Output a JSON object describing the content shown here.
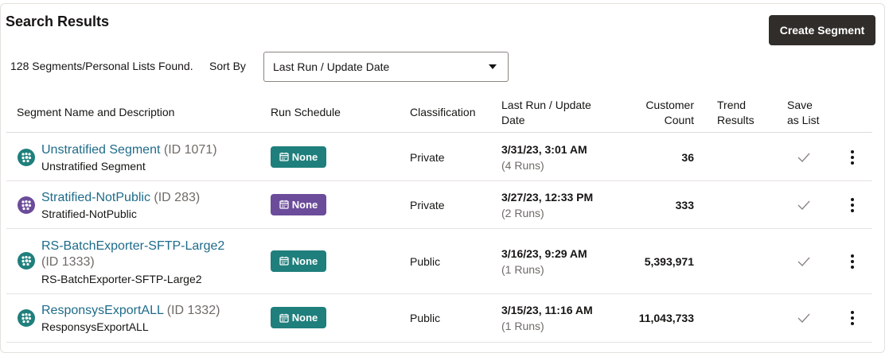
{
  "header": {
    "title": "Search Results",
    "create_button": "Create Segment"
  },
  "summary": {
    "found_text": "128 Segments/Personal Lists Found.",
    "sort_label": "Sort By",
    "sort_value": "Last Run / Update Date"
  },
  "columns": {
    "name": "Segment Name and Description",
    "schedule": "Run Schedule",
    "classification": "Classification",
    "last_run_1": "Last Run / Update",
    "last_run_2": "Date",
    "count_1": "Customer",
    "count_2": "Count",
    "trend_1": "Trend",
    "trend_2": "Results",
    "save_1": "Save",
    "save_2": "as List"
  },
  "colors": {
    "teal": "#1f7f7c",
    "purple": "#6b4c9a",
    "link": "#1e6b8a"
  },
  "rows": [
    {
      "name": "Unstratified Segment",
      "id": "(ID 1071)",
      "desc": "Unstratified Segment",
      "schedule": "None",
      "classification": "Private",
      "date": "3/31/23, 3:01 AM",
      "runs": "(4 Runs)",
      "count": "36",
      "icon": "segment-icon"
    },
    {
      "name": "Stratified-NotPublic",
      "id": "(ID 283)",
      "desc": "Stratified-NotPublic",
      "schedule": "None",
      "classification": "Private",
      "date": "3/27/23, 12:33 PM",
      "runs": "(2 Runs)",
      "count": "333",
      "icon": "segment-icon"
    },
    {
      "name": "RS-BatchExporter-SFTP-Large2",
      "id": "(ID 1333)",
      "desc": "RS-BatchExporter-SFTP-Large2",
      "schedule": "None",
      "classification": "Public",
      "date": "3/16/23, 9:29 AM",
      "runs": "(1 Runs)",
      "count": "5,393,971",
      "icon": "segment-icon"
    },
    {
      "name": "ResponsysExportALL",
      "id": "(ID 1332)",
      "desc": "ResponsysExportALL",
      "schedule": "None",
      "classification": "Public",
      "date": "3/15/23, 11:16 AM",
      "runs": "(1 Runs)",
      "count": "11,043,733",
      "icon": "segment-icon"
    }
  ]
}
